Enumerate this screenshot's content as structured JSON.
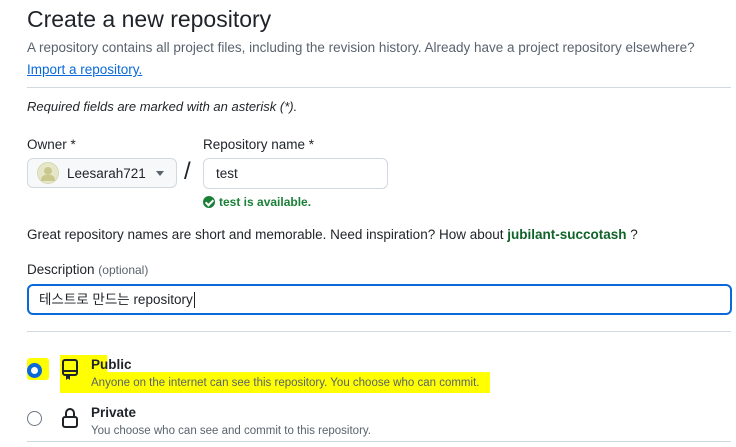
{
  "header": {
    "title": "Create a new repository",
    "subtitle": "A repository contains all project files, including the revision history. Already have a project repository elsewhere?",
    "import_link": "Import a repository."
  },
  "required_note": "Required fields are marked with an asterisk (*).",
  "owner": {
    "label": "Owner *",
    "value": "Leesarah721"
  },
  "slash": "/",
  "repo_name": {
    "label": "Repository name *",
    "value": "test",
    "availability": "test is available."
  },
  "inspiration": {
    "text": "Great repository names are short and memorable. Need inspiration? How about",
    "suggestion": "jubilant-succotash",
    "end": "?"
  },
  "description": {
    "label": "Description",
    "optional": "(optional)",
    "value": "테스트로 만드는  repository"
  },
  "visibility": {
    "options": [
      {
        "title": "Public",
        "desc": "Anyone on the internet can see this repository. You choose who can commit.",
        "selected": true,
        "icon": "repo-icon"
      },
      {
        "title": "Private",
        "desc": "You choose who can see and commit to this repository.",
        "selected": false,
        "icon": "lock-icon"
      }
    ]
  },
  "colors": {
    "accent": "#0969da",
    "success": "#1a7f37",
    "highlight": "#ffff00"
  }
}
